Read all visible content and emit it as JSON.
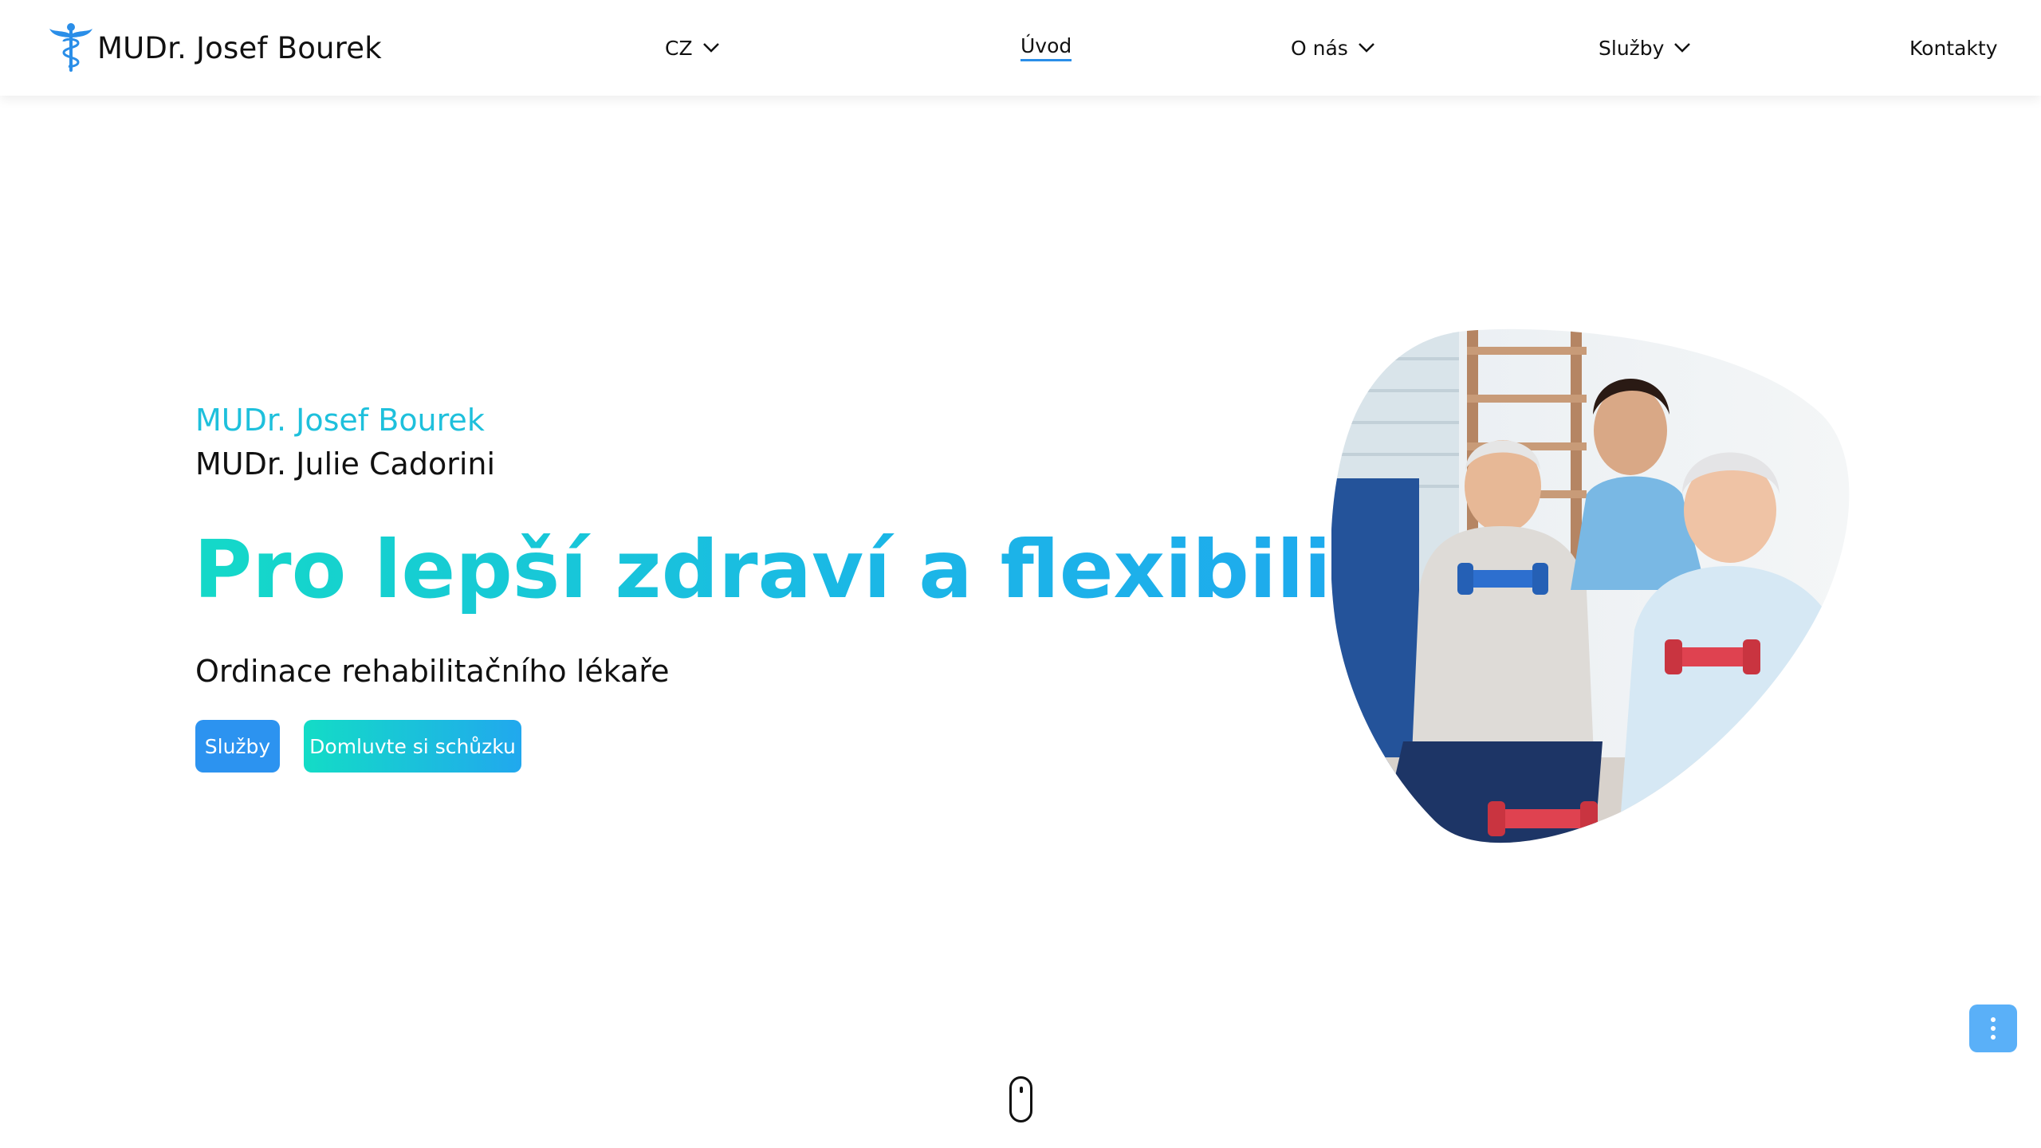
{
  "brand": {
    "name": "MUDr. Josef Bourek",
    "logo_icon": "caduceus-icon",
    "accent_color": "#2a8ee8"
  },
  "nav": {
    "lang": "CZ",
    "home": "Úvod",
    "about": "O nás",
    "services": "Služby",
    "contacts": "Kontakty"
  },
  "hero": {
    "doctor1": "MUDr. Josef Bourek",
    "doctor2": "MUDr. Julie Cadorini",
    "headline": "Pro lepší zdraví a flexibilitu",
    "tagline": "Ordinace rehabilitačního lékaře",
    "btn_services": "Služby",
    "btn_appointment": "Domluvte si schůzku",
    "photo_icon": "seniors-exercising-photo"
  },
  "floating_menu": {
    "icon": "more-vertical-icon"
  },
  "scroll_indicator": {
    "icon": "mouse-scroll-icon"
  }
}
